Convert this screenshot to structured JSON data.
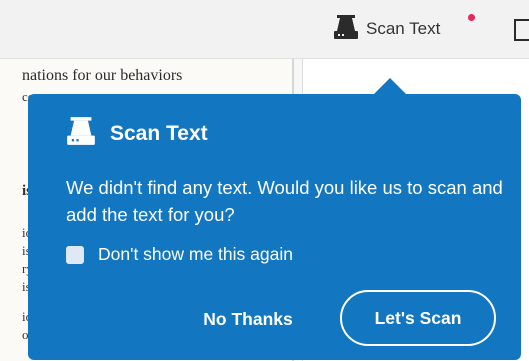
{
  "toolbar": {
    "scan_text_label": "Scan Text",
    "notification_color": "#e8285a"
  },
  "document": {
    "visible_line": "nations for our behaviors",
    "margin_fragments": [
      "co",
      "is",
      "io",
      "is",
      "ry",
      "is",
      "io",
      "o"
    ]
  },
  "popover": {
    "title": "Scan Text",
    "message": "We didn't find any text. Would you like us to scan and add the text for you?",
    "checkbox_label": "Don't show me this again",
    "checkbox_checked": false,
    "secondary_button": "No Thanks",
    "primary_button": "Let's Scan",
    "background_color": "#1276c1"
  }
}
